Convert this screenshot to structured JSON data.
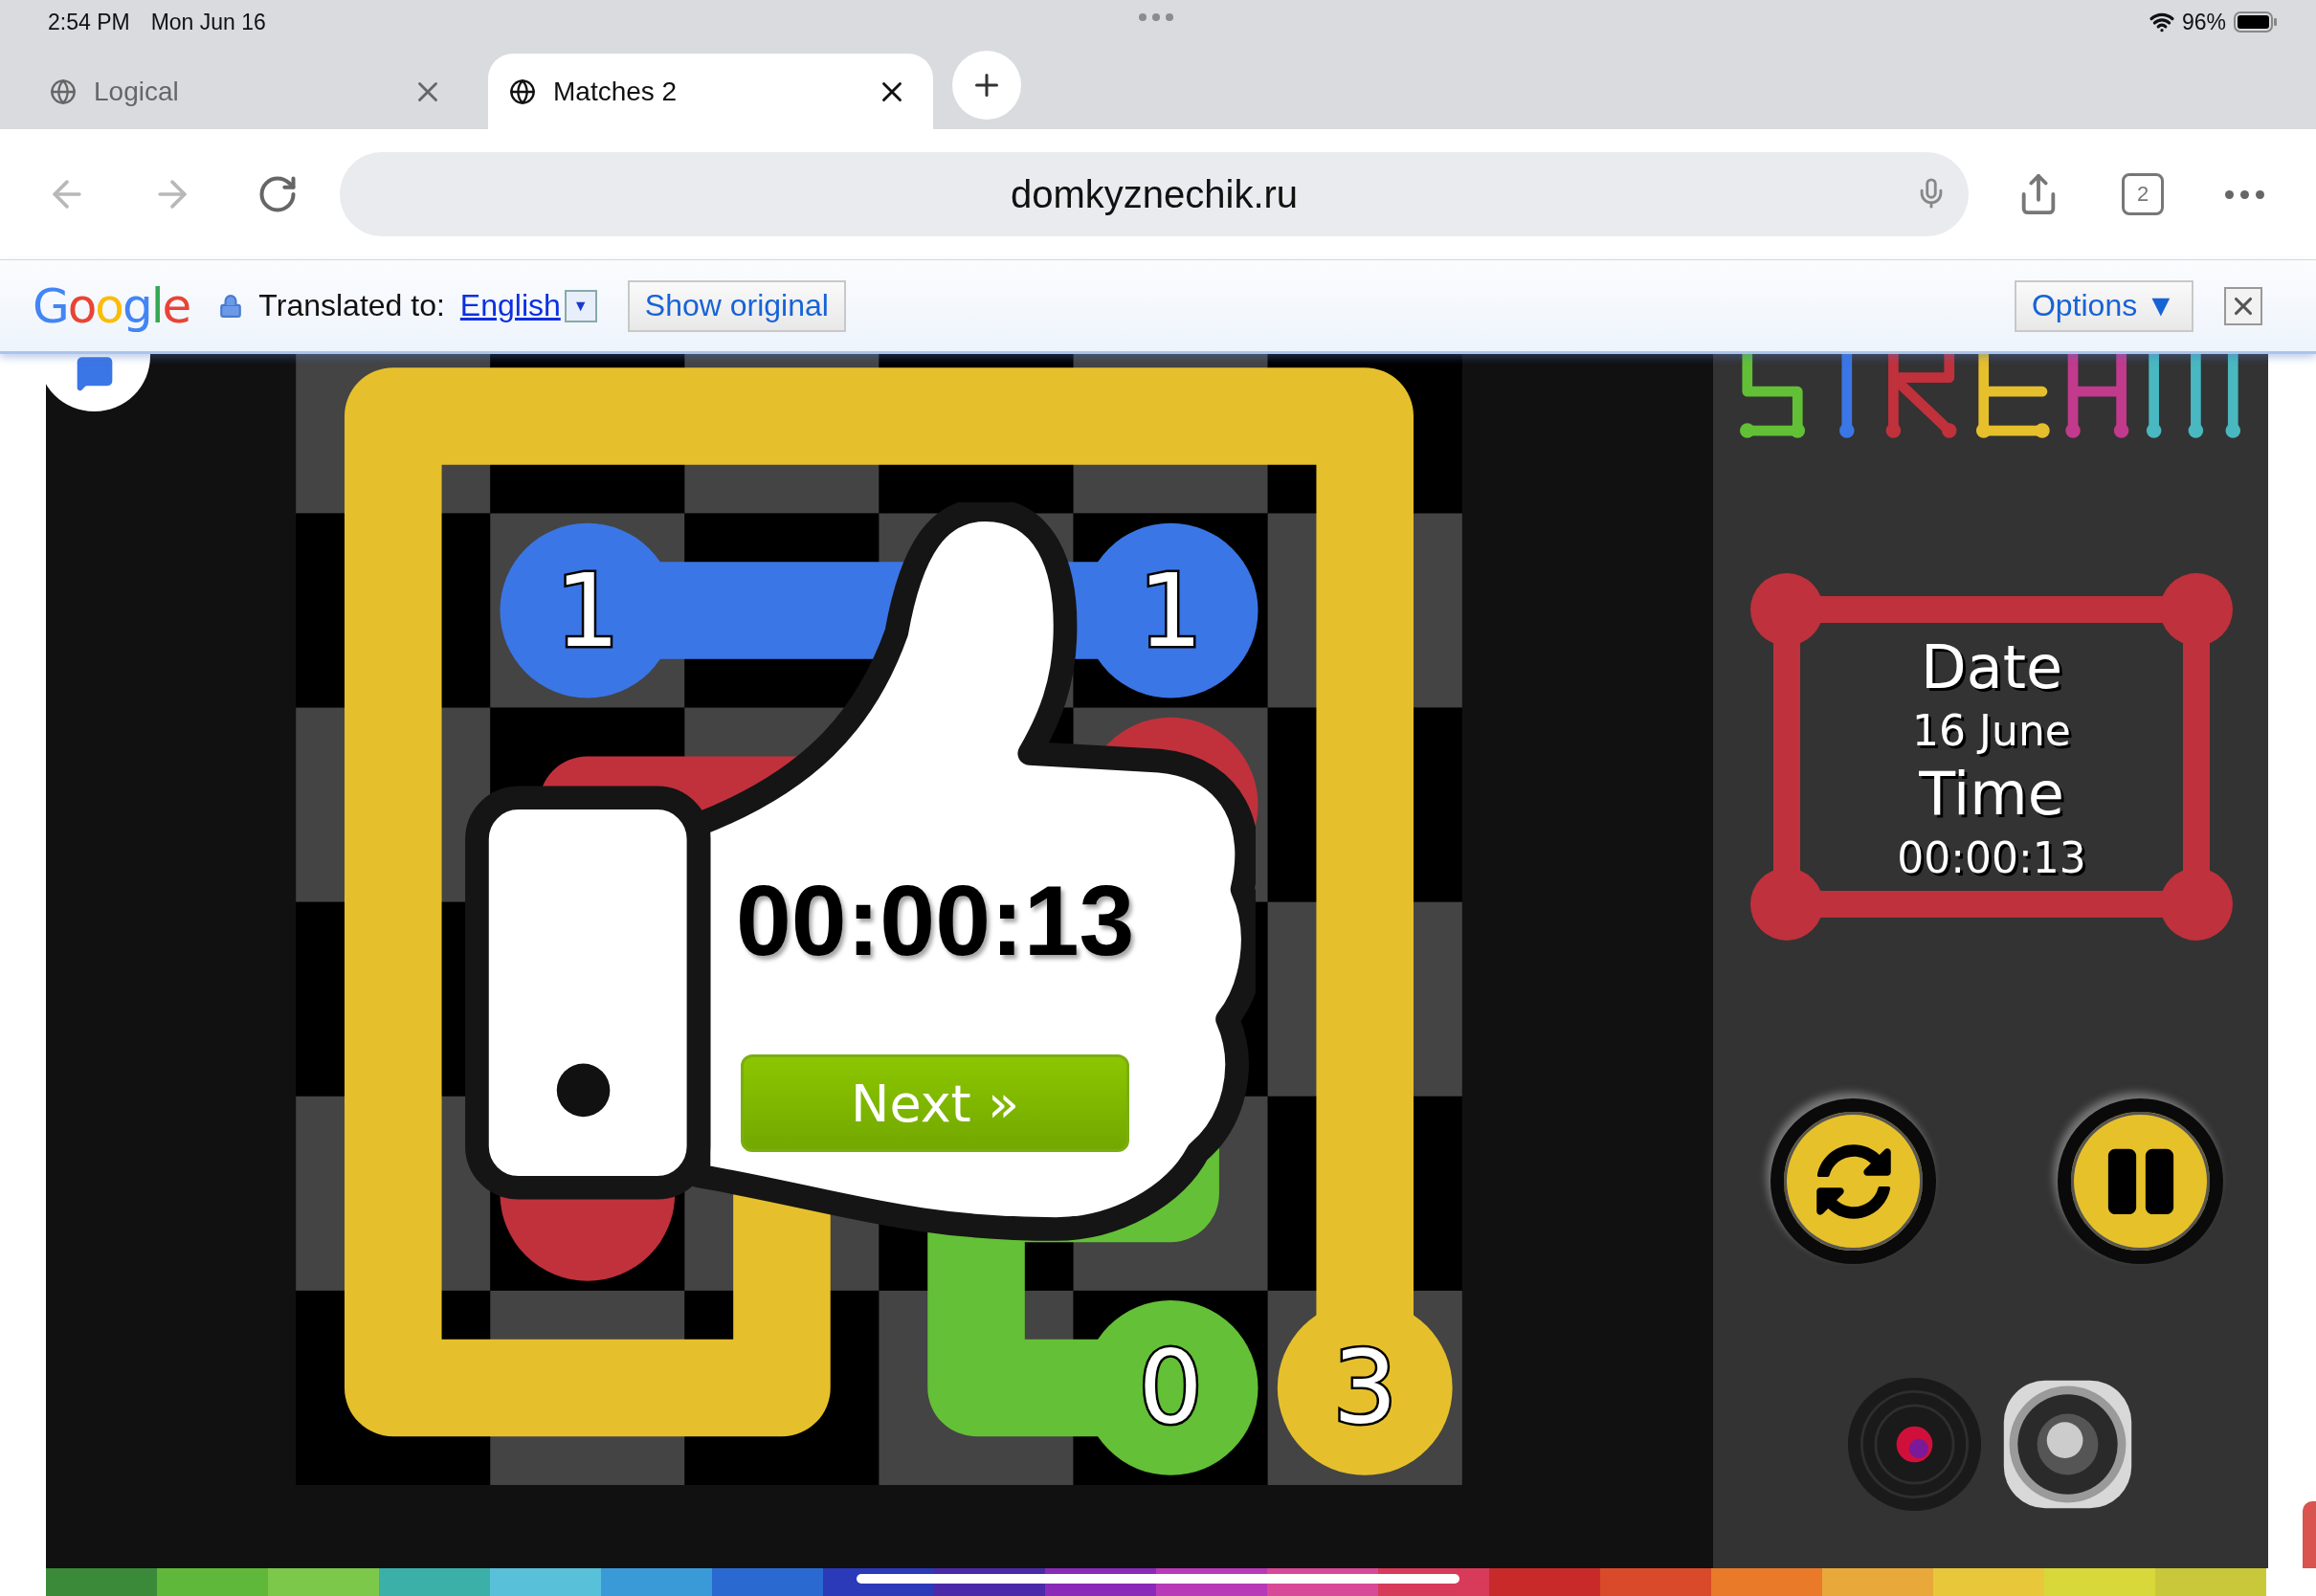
{
  "status_bar": {
    "time": "2:54 PM",
    "date": "Mon Jun 16",
    "battery": "96%"
  },
  "tabs": [
    {
      "title": "Logical",
      "selected": false
    },
    {
      "title": "Matches 2",
      "selected": true
    }
  ],
  "toolbar": {
    "url": "domkyznechik.ru",
    "tab_count": "2"
  },
  "translate_bar": {
    "brand": "Google",
    "label": "Translated to:",
    "language": "English",
    "dropdown": "▼",
    "show_original": "Show original",
    "options": "Options ▼"
  },
  "board": {
    "pairs": [
      {
        "color": "#3b76e6",
        "labels": [
          "1",
          "1"
        ]
      },
      {
        "color": "#c0313c"
      },
      {
        "color": "#64c037",
        "labels": [
          "0"
        ]
      },
      {
        "color": "#e6c02c",
        "labels": [
          "3"
        ]
      }
    ]
  },
  "result": {
    "time": "00:00:13",
    "next": "Next »"
  },
  "panel": {
    "date_label": "Date",
    "date": "16 June",
    "time_label": "Time",
    "time": "00:00:13"
  }
}
